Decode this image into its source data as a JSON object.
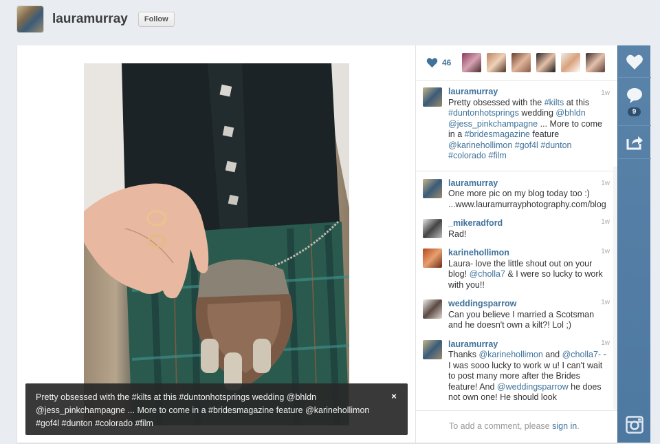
{
  "header": {
    "username": "lauramurray",
    "follow_label": "Follow"
  },
  "post": {
    "caption_parts": [
      "Pretty obsessed with the ",
      "#kilts",
      " at this ",
      "#duntonhotsprings",
      " wedding ",
      "@bhldn",
      " ",
      "@jess_pinkchampagne",
      " ... More to come in a ",
      "#bridesmagazine",
      " feature ",
      "@karinehollimon",
      " ",
      "#gof4l",
      " ",
      "#dunton",
      " ",
      "#colorado",
      " ",
      "#film"
    ],
    "close_glyph": "×"
  },
  "likes": {
    "count": "46"
  },
  "comments": [
    {
      "user": "lauramurray",
      "time": "1w",
      "text": "Pretty obsessed with the #kilts at this #duntonhotsprings wedding @bhldn @jess_pinkchampagne ... More to come in a #bridesmagazine feature @karinehollimon #gof4l #dunton #colorado #film"
    },
    {
      "user": "lauramurray",
      "time": "1w",
      "text": "One more pic on my blog today too :) ...www.lauramurrayphotography.com/blog"
    },
    {
      "user": "_mikeradford",
      "time": "1w",
      "text": "Rad!"
    },
    {
      "user": "karinehollimon",
      "time": "1w",
      "text": "Laura- love the little shout out on your blog! @cholla7 & I were so lucky to work with you!!"
    },
    {
      "user": "weddingsparrow",
      "time": "1w",
      "text": "Can you believe I married a Scotsman and he doesn't own a kilt?! Lol ;)"
    },
    {
      "user": "lauramurray",
      "time": "1w",
      "text": "Thanks @karinehollimon and @cholla7- - I was sooo lucky to work w u! I can't wait to post many more after the Brides feature! And @weddingsparrow he does not own one! He should look"
    }
  ],
  "add_comment": {
    "prefix": "To add a comment, please ",
    "link": "sign in",
    "suffix": "."
  },
  "actions": {
    "comment_count": "9"
  },
  "colors": {
    "link": "#3f729b",
    "action_bar": "#5a83a9"
  }
}
